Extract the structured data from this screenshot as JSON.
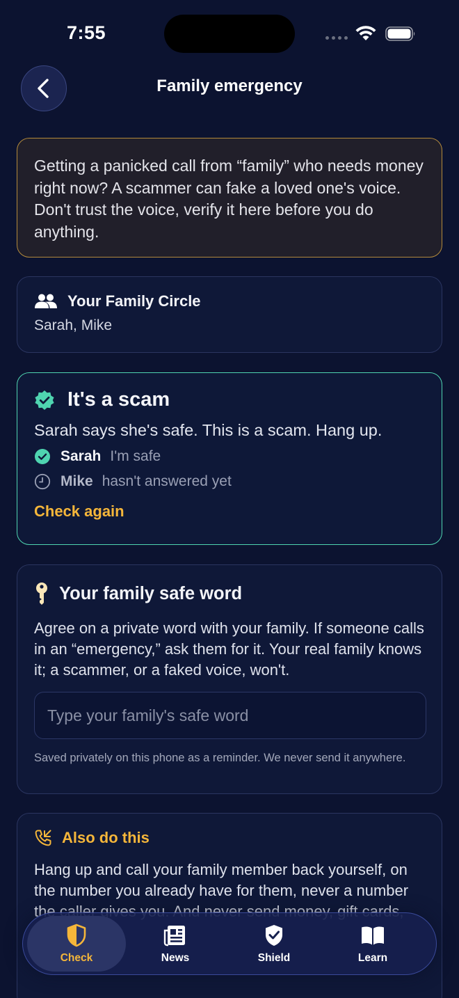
{
  "status_bar": {
    "time": "7:55"
  },
  "header": {
    "title": "Family emergency"
  },
  "intro": {
    "text": "Getting a panicked call from “family” who needs money right now? A scammer can fake a loved one's voice. Don't trust the voice, verify it here before you do anything."
  },
  "family_circle": {
    "title": "Your Family Circle",
    "members": "Sarah, Mike"
  },
  "result": {
    "title": "It's a scam",
    "message": "Sarah says she's safe. This is a scam. Hang up.",
    "members": [
      {
        "name": "Sarah",
        "status": "I'm safe"
      },
      {
        "name": "Mike",
        "status": "hasn't answered yet"
      }
    ],
    "check_again": "Check again",
    "accent_color": "#4fd4b0"
  },
  "safe_word": {
    "title": "Your family safe word",
    "body": "Agree on a private word with your family. If someone calls in an “emergency,” ask them for it. Your real family knows it; a scammer, or a faked voice, won't.",
    "placeholder": "Type your family's safe word",
    "value": "",
    "note": "Saved privately on this phone as a reminder. We never send it anywhere."
  },
  "also": {
    "title": "Also do this",
    "body": "Hang up and call your family member back yourself, on the number you already have for them, never a number the caller gives you. And never send money, gift cards,"
  },
  "tabs": [
    {
      "label": "Check",
      "icon": "shield-half-icon",
      "active": true
    },
    {
      "label": "News",
      "icon": "newspaper-icon",
      "active": false
    },
    {
      "label": "Shield",
      "icon": "shield-check-icon",
      "active": false
    },
    {
      "label": "Learn",
      "icon": "book-open-icon",
      "active": false
    }
  ],
  "colors": {
    "accent": "#f5b63a",
    "success": "#4fd4b0",
    "background": "#0c1330"
  }
}
